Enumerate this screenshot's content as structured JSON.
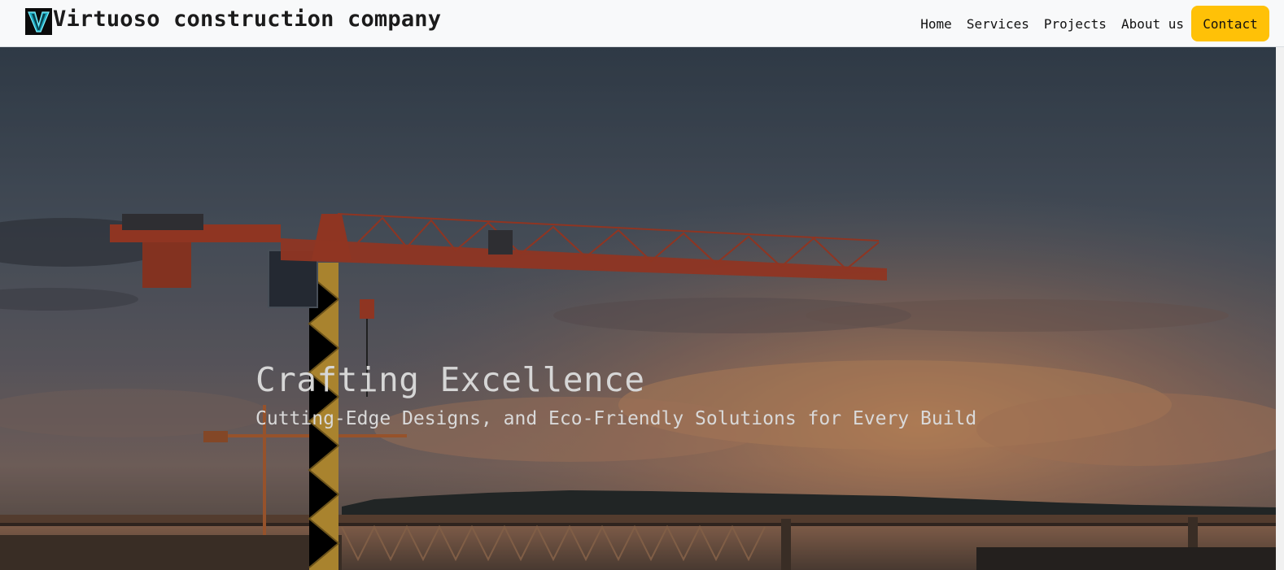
{
  "navbar": {
    "brand": {
      "logo_letter": "V",
      "title": "Virtuoso construction company"
    },
    "links": [
      {
        "label": "Home"
      },
      {
        "label": "Services"
      },
      {
        "label": "Projects"
      },
      {
        "label": "About us"
      }
    ],
    "contact_label": "Contact"
  },
  "hero": {
    "title": "Crafting Excellence",
    "subtitle": "Cutting-Edge Designs, and Eco-Friendly Solutions for Every Build"
  },
  "colors": {
    "navbar_bg": "#f8f9fa",
    "accent_button": "#ffc107",
    "logo_bg": "#0b0b0b",
    "logo_letter": "#3fd0e8",
    "crane_red": "#b8442c",
    "crane_yellow": "#e0b23a"
  },
  "icons": {
    "logo": "v-letter-logo-icon"
  }
}
